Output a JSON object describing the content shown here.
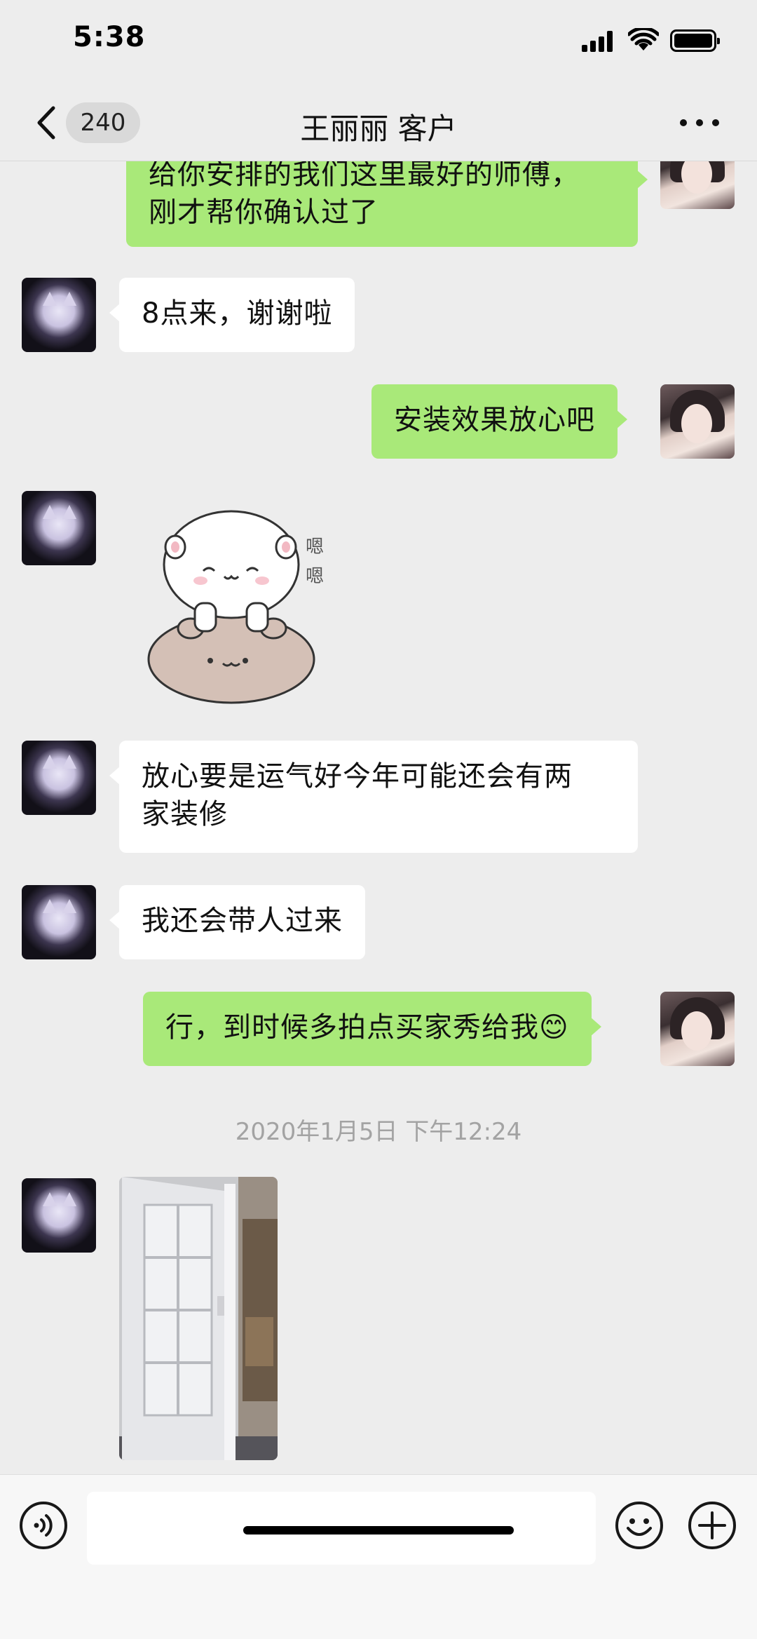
{
  "status_bar": {
    "time": "5:38"
  },
  "nav": {
    "back_count": "240",
    "title": "王丽丽 客户"
  },
  "messages": [
    {
      "from": "me",
      "lines": [
        "给你安排的我们这里最好的师傅，",
        "刚才帮你确认过了"
      ]
    },
    {
      "from": "them",
      "text": "8点来，谢谢啦"
    },
    {
      "from": "me",
      "text": "安装效果放心吧"
    },
    {
      "from": "them",
      "type": "sticker",
      "sticker_text": [
        "嗯",
        "嗯"
      ]
    },
    {
      "from": "them",
      "lines": [
        "放心要是运气好今年可能还会有两",
        "家装修"
      ]
    },
    {
      "from": "them",
      "text": "我还会带人过来"
    },
    {
      "from": "me",
      "text": "行，到时候多拍点买家秀给我",
      "emoji": "😊"
    },
    {
      "type": "timestamp",
      "text": "2020年1月5日 下午12:24"
    },
    {
      "from": "them",
      "type": "image",
      "image": "door-photo"
    }
  ],
  "input": {
    "placeholder": "",
    "value": ""
  },
  "icons": {
    "back": "chevron-left-icon",
    "more": "ellipsis-icon",
    "voice": "voice-icon",
    "emoji": "emoji-icon",
    "plus": "plus-icon"
  },
  "colors": {
    "background": "#ededed",
    "my_bubble": "#a9e979",
    "their_bubble": "#ffffff",
    "timestamp": "#a3a3a3"
  }
}
